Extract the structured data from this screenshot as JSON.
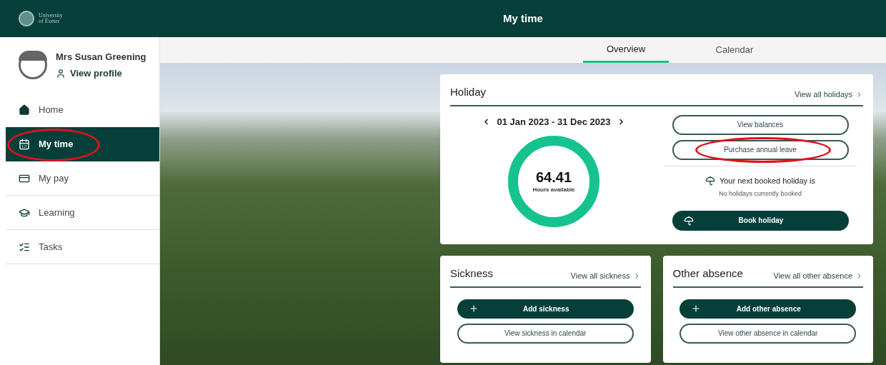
{
  "header": {
    "logo_text": [
      "University",
      "of Exeter"
    ],
    "title": "My time"
  },
  "profile": {
    "name": "Mrs Susan Greening",
    "link": "View profile"
  },
  "nav": [
    {
      "label": "Home",
      "selected": false,
      "circled": false
    },
    {
      "label": "My time",
      "selected": true,
      "circled": true
    },
    {
      "label": "My pay",
      "selected": false,
      "circled": false
    },
    {
      "label": "Learning",
      "selected": false,
      "circled": false
    },
    {
      "label": "Tasks",
      "selected": false,
      "circled": false
    }
  ],
  "tabs": [
    {
      "label": "Overview",
      "selected": true
    },
    {
      "label": "Calendar",
      "selected": false
    }
  ],
  "holiday": {
    "title": "Holiday",
    "link": "View all holidays",
    "period": "01 Jan 2023 - 31 Dec 2023",
    "hours": "64.41",
    "hours_label": "Hours available",
    "buttons": [
      {
        "label": "View balances",
        "circled": false
      },
      {
        "label": "Purchase annual leave",
        "circled": true
      }
    ],
    "next_title": "Your next booked holiday is",
    "next_text": "No holidays currently booked",
    "book": "Book holiday"
  },
  "absence_cards": [
    {
      "title": "Sickness",
      "link": "View all sickness",
      "add": "Add sickness",
      "view": "View sickness in calendar"
    },
    {
      "title": "Other absence",
      "link": "View all other absence",
      "add": "Add other absence",
      "view": "View other absence in calendar"
    }
  ]
}
